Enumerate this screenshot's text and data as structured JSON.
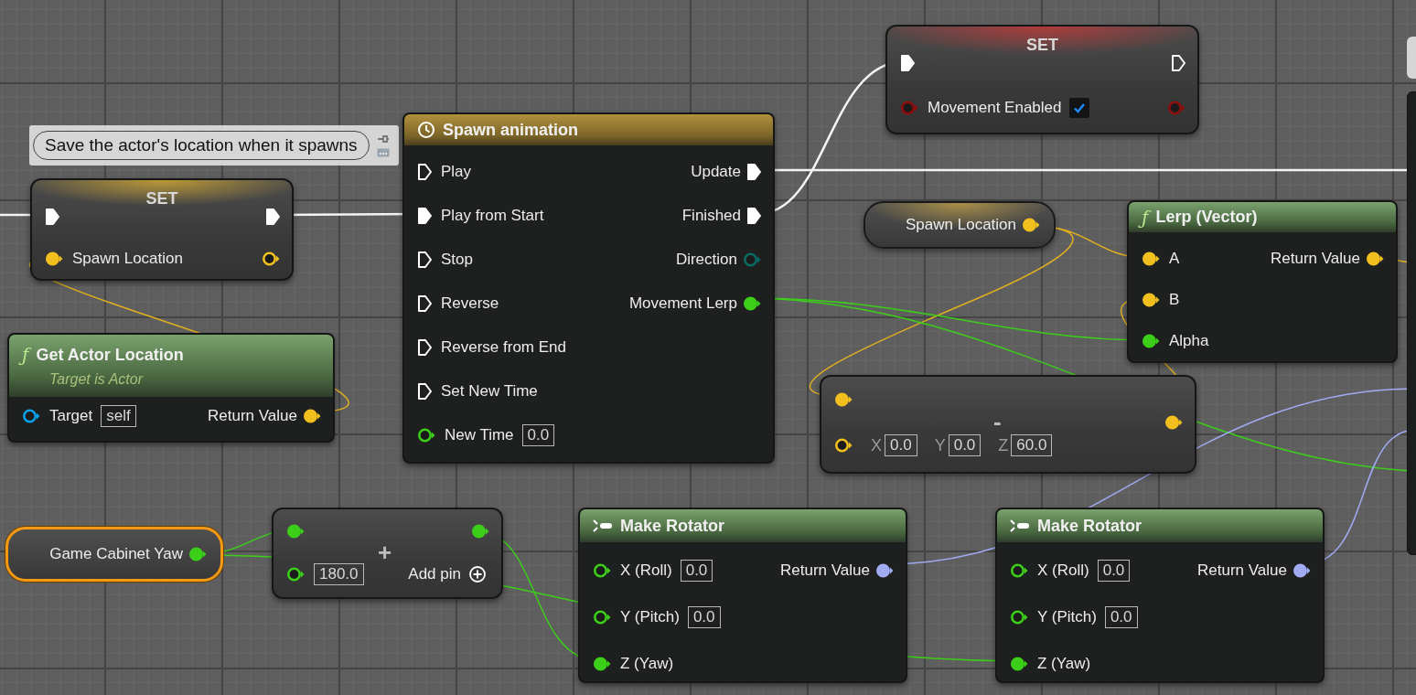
{
  "nodes": [
    {
      "kind": "comment",
      "text": "Save the actor's location when it spawns"
    },
    {
      "kind": "set",
      "title": "SET",
      "inputs": [
        {
          "kind": "exec",
          "connected": true
        },
        {
          "kind": "vector",
          "label": "Spawn Location",
          "connected": true
        }
      ],
      "outputs": [
        {
          "kind": "exec",
          "connected": true
        },
        {
          "kind": "vector",
          "connected": false
        }
      ]
    },
    {
      "kind": "function",
      "icon": "ƒ",
      "title": "Get Actor Location",
      "subtitle": "Target is Actor",
      "inputs": [
        {
          "kind": "object",
          "label": "Target",
          "value": "self",
          "connected": false
        }
      ],
      "outputs": [
        {
          "kind": "vector",
          "label": "Return Value",
          "connected": true
        }
      ]
    },
    {
      "kind": "timeline",
      "title": "Spawn animation",
      "inputs": [
        {
          "kind": "exec",
          "label": "Play",
          "connected": false
        },
        {
          "kind": "exec",
          "label": "Play from Start",
          "connected": true
        },
        {
          "kind": "exec",
          "label": "Stop",
          "connected": false
        },
        {
          "kind": "exec",
          "label": "Reverse",
          "connected": false
        },
        {
          "kind": "exec",
          "label": "Reverse from End",
          "connected": false
        },
        {
          "kind": "exec",
          "label": "Set New Time",
          "connected": false
        },
        {
          "kind": "float",
          "label": "New Time",
          "value": "0.0",
          "connected": false
        }
      ],
      "outputs": [
        {
          "kind": "exec",
          "label": "Update",
          "connected": true
        },
        {
          "kind": "exec",
          "label": "Finished",
          "connected": true
        },
        {
          "kind": "enum",
          "label": "Direction",
          "connected": false
        },
        {
          "kind": "float",
          "label": "Movement Lerp",
          "connected": true
        }
      ]
    },
    {
      "kind": "set",
      "title": "SET",
      "inputs": [
        {
          "kind": "exec",
          "connected": true
        },
        {
          "kind": "bool",
          "label": "Movement Enabled",
          "checked": true,
          "connected": false
        }
      ],
      "outputs": [
        {
          "kind": "exec",
          "connected": false
        },
        {
          "kind": "bool",
          "connected": false
        }
      ]
    },
    {
      "kind": "getter",
      "label": "Spawn Location",
      "selected": false,
      "outputs": [
        {
          "kind": "vector",
          "connected": true
        }
      ]
    },
    {
      "kind": "function",
      "icon": "ƒ",
      "title": "Lerp (Vector)",
      "inputs": [
        {
          "kind": "vector",
          "label": "A",
          "connected": true
        },
        {
          "kind": "vector",
          "label": "B",
          "connected": true
        },
        {
          "kind": "float",
          "label": "Alpha",
          "connected": true
        }
      ],
      "outputs": [
        {
          "kind": "vector",
          "label": "Return Value",
          "connected": true
        }
      ]
    },
    {
      "kind": "math",
      "symbol": "-",
      "inputs": [
        {
          "kind": "vector",
          "connected": true
        },
        {
          "kind": "vector",
          "connected": false,
          "fields": [
            {
              "axis": "X",
              "value": "0.0"
            },
            {
              "axis": "Y",
              "value": "0.0"
            },
            {
              "axis": "Z",
              "value": "60.0"
            }
          ]
        }
      ],
      "outputs": [
        {
          "kind": "vector",
          "connected": true
        }
      ]
    },
    {
      "kind": "getter",
      "label": "Game Cabinet Yaw",
      "selected": true,
      "outputs": [
        {
          "kind": "float",
          "connected": true
        }
      ]
    },
    {
      "kind": "math",
      "symbol": "+",
      "add_pin": "Add pin",
      "inputs": [
        {
          "kind": "float",
          "connected": true
        },
        {
          "kind": "float",
          "value": "180.0",
          "connected": false
        }
      ],
      "outputs": [
        {
          "kind": "float",
          "connected": true
        }
      ]
    },
    {
      "kind": "make",
      "title": "Make Rotator",
      "inputs": [
        {
          "kind": "float",
          "label": "X (Roll)",
          "value": "0.0",
          "connected": false
        },
        {
          "kind": "float",
          "label": "Y (Pitch)",
          "value": "0.0",
          "connected": false
        },
        {
          "kind": "float",
          "label": "Z (Yaw)",
          "connected": true
        }
      ],
      "outputs": [
        {
          "kind": "rotator",
          "label": "Return Value",
          "connected": true
        }
      ]
    },
    {
      "kind": "make",
      "title": "Make Rotator",
      "inputs": [
        {
          "kind": "float",
          "label": "X (Roll)",
          "value": "0.0",
          "connected": false
        },
        {
          "kind": "float",
          "label": "Y (Pitch)",
          "value": "0.0",
          "connected": false
        },
        {
          "kind": "float",
          "label": "Z (Yaw)",
          "connected": true
        }
      ],
      "outputs": [
        {
          "kind": "rotator",
          "label": "Return Value",
          "connected": true
        }
      ]
    }
  ]
}
